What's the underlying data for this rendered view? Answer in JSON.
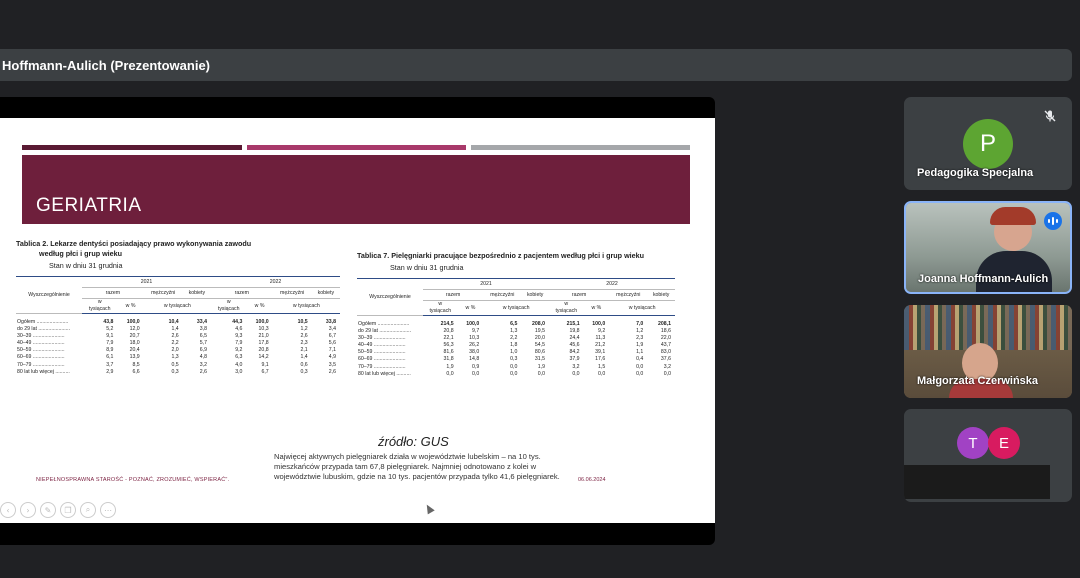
{
  "meeting": {
    "presenter_label": "Hoffmann-Aulich (Prezentowanie)"
  },
  "slide": {
    "bar_colors": [
      "#5a1a33",
      "#a8396a",
      "#a5a7aa"
    ],
    "banner_color": "#6e1f3c",
    "title": "GERIATRIA",
    "table1": {
      "title_line1": "Tablica 2. Lekarze dentyści posiadający prawo wykonywania zawodu",
      "title_line2": "według płci i grup wieku",
      "subtitle": "Stan w dniu 31 grudnia",
      "header": {
        "row_label": "Wyszczególnienie",
        "year1": "2021",
        "year2": "2022",
        "razem": "razem",
        "mezczyzni": "mężczyźni",
        "kobiety": "kobiety",
        "w_tys": "w tysiącach",
        "w_proc": "w %",
        "w_tys_line1": "w",
        "w_tys_line2": "tysiącach"
      },
      "rows": [
        {
          "label": "Ogółem ......................",
          "v": [
            "43,8",
            "100,0",
            "10,4",
            "33,4",
            "44,3",
            "100,0",
            "10,5",
            "33,8"
          ]
        },
        {
          "label": "do 29 lat ......................",
          "v": [
            "5,2",
            "12,0",
            "1,4",
            "3,8",
            "4,6",
            "10,3",
            "1,2",
            "3,4"
          ]
        },
        {
          "label": "30–39 ......................",
          "v": [
            "9,1",
            "20,7",
            "2,6",
            "6,5",
            "9,3",
            "21,0",
            "2,6",
            "6,7"
          ]
        },
        {
          "label": "40–49 ......................",
          "v": [
            "7,9",
            "18,0",
            "2,2",
            "5,7",
            "7,9",
            "17,8",
            "2,3",
            "5,6"
          ]
        },
        {
          "label": "50–59 ......................",
          "v": [
            "8,9",
            "20,4",
            "2,0",
            "6,9",
            "9,2",
            "20,8",
            "2,1",
            "7,1"
          ]
        },
        {
          "label": "60–69 ......................",
          "v": [
            "6,1",
            "13,9",
            "1,3",
            "4,8",
            "6,3",
            "14,2",
            "1,4",
            "4,9"
          ]
        },
        {
          "label": "70–79 ......................",
          "v": [
            "3,7",
            "8,5",
            "0,5",
            "3,2",
            "4,0",
            "9,1",
            "0,6",
            "3,5"
          ]
        },
        {
          "label": "80 lat lub więcej ..........",
          "v": [
            "2,9",
            "6,6",
            "0,3",
            "2,6",
            "3,0",
            "6,7",
            "0,3",
            "2,6"
          ]
        }
      ]
    },
    "table2": {
      "title_line1": "Tablica 7. Pielęgniarki pracujące bezpośrednio z pacjentem według płci i grup wieku",
      "subtitle": "Stan w dniu 31 grudnia",
      "header": {
        "row_label": "Wyszczególnienie",
        "year1": "2021",
        "year2": "2022",
        "razem": "razem",
        "mezczyzni": "mężczyźni",
        "kobiety": "kobiety",
        "w_tys": "w tysiącach",
        "w_proc": "w %",
        "w_tys_line1": "w",
        "w_tys_line2": "tysiącach"
      },
      "rows": [
        {
          "label": "Ogółem ......................",
          "v": [
            "214,5",
            "100,0",
            "6,5",
            "208,0",
            "215,1",
            "100,0",
            "7,0",
            "208,1"
          ]
        },
        {
          "label": "do 29 lat ......................",
          "v": [
            "20,8",
            "9,7",
            "1,3",
            "19,5",
            "19,8",
            "9,2",
            "1,2",
            "18,6"
          ]
        },
        {
          "label": "30–39 ......................",
          "v": [
            "22,1",
            "10,3",
            "2,2",
            "20,0",
            "24,4",
            "11,3",
            "2,3",
            "22,0"
          ]
        },
        {
          "label": "40–49 ......................",
          "v": [
            "56,3",
            "26,2",
            "1,8",
            "54,5",
            "45,6",
            "21,2",
            "1,9",
            "43,7"
          ]
        },
        {
          "label": "50–59 ......................",
          "v": [
            "81,6",
            "38,0",
            "1,0",
            "80,6",
            "84,2",
            "39,1",
            "1,1",
            "83,0"
          ]
        },
        {
          "label": "60–69 ......................",
          "v": [
            "31,8",
            "14,8",
            "0,3",
            "31,5",
            "37,9",
            "17,6",
            "0,4",
            "37,6"
          ]
        },
        {
          "label": "70–79 ......................",
          "v": [
            "1,9",
            "0,9",
            "0,0",
            "1,9",
            "3,2",
            "1,5",
            "0,0",
            "3,2"
          ]
        },
        {
          "label": "80 lat lub więcej ..........",
          "v": [
            "0,0",
            "0,0",
            "0,0",
            "0,0",
            "0,0",
            "0,0",
            "0,0",
            "0,0"
          ]
        }
      ]
    },
    "source": "źródło: GUS",
    "note": "Najwięcej aktywnych pielęgniarek działa w województwie lubelskim – na 10 tys. mieszkańców przypada tam 67,8 pielęgniarek. Najmniej odnotowano z kolei w województwie lubuskim, gdzie na 10 tys. pacjentów przypada tylko 41,6 pielęgniarek.",
    "footer_left": "NIEPEŁNOSPRAWNA STAROŚĆ - POZNAĆ, ZROZUMIEĆ, WSPIERAĆ\".",
    "footer_right": "06.06.2024"
  },
  "participants": [
    {
      "name": "Pedagogika Specjalna",
      "initial": "P",
      "avatar_color": "#5da532",
      "muted": true
    },
    {
      "name": "Joanna Hoffmann-Aulich",
      "speaking": true,
      "border_color": "#8ab4f8"
    },
    {
      "name": "Małgorzata Czerwińska"
    },
    {
      "initials": [
        "T",
        "E"
      ],
      "avatar_colors": [
        "#a142c4",
        "#d81b60"
      ]
    }
  ]
}
